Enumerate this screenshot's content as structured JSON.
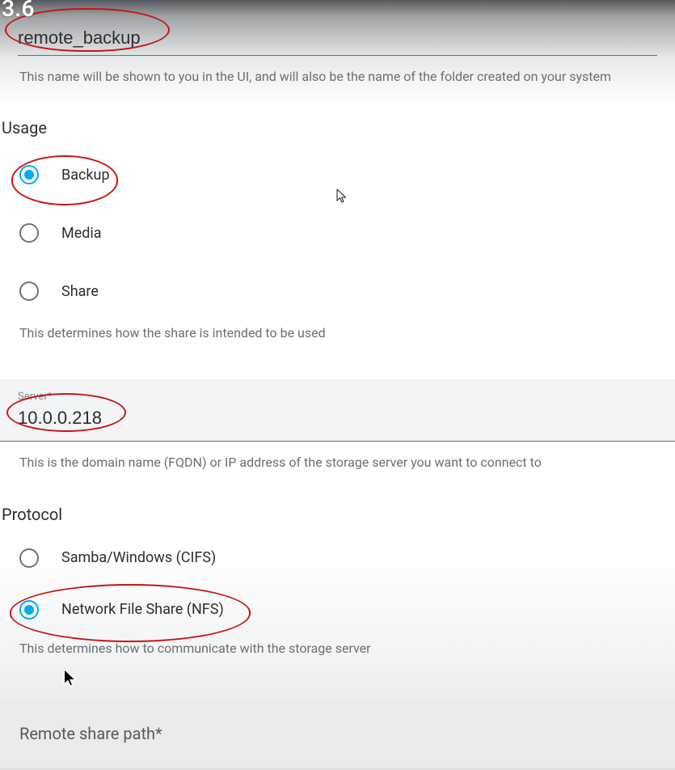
{
  "overlay_time": "3.6",
  "name_field": {
    "label": "Name*",
    "value": "remote_backup",
    "help": "This name will be shown to you in the UI, and will also be the name of the folder created on your system"
  },
  "usage": {
    "title": "Usage",
    "options": [
      "Backup",
      "Media",
      "Share"
    ],
    "selected": 0,
    "help": "This determines how the share is intended to be used"
  },
  "server_field": {
    "label": "Server*",
    "value": "10.0.0.218",
    "help": "This is the domain name (FQDN) or IP address of the storage server you want to connect to"
  },
  "protocol": {
    "title": "Protocol",
    "options": [
      "Samba/Windows (CIFS)",
      "Network File Share (NFS)"
    ],
    "selected": 1,
    "help": "This determines how to communicate with the storage server"
  },
  "remote_path": {
    "label": "Remote share path*"
  }
}
